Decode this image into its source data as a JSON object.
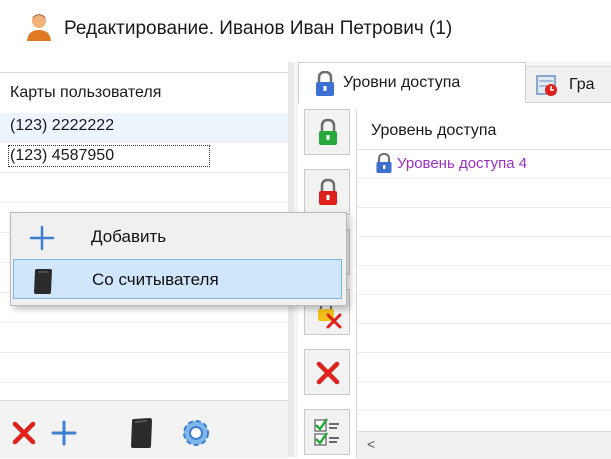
{
  "window": {
    "title": "Редактирование. Иванов Иван Петрович (1)",
    "icon": "user-icon"
  },
  "cards_panel": {
    "header": "Карты пользователя",
    "rows": [
      "(123) 2222222",
      "(123) 4587950"
    ],
    "toolbar": {
      "buttons": [
        "delete-icon",
        "add-icon",
        "card-reader-icon",
        "settings-icon"
      ]
    }
  },
  "context_menu": {
    "items": [
      {
        "label": "Добавить",
        "icon": "add-icon"
      },
      {
        "label": "Со считывателя",
        "icon": "card-reader-icon"
      }
    ],
    "highlighted_index": 1
  },
  "tabs": [
    {
      "label": "Уровни доступа",
      "icon": "lock-icon",
      "active": true
    },
    {
      "label": "Гра",
      "icon": "schedule-icon",
      "active": false
    }
  ],
  "access_levels": {
    "column_header": "Уровень доступа",
    "rows": [
      "Уровень доступа 4"
    ],
    "row_color": "#9b2fc6",
    "scroll_arrow": "<"
  },
  "side_toolbar": {
    "buttons": [
      "unlock-green-icon",
      "lock-red-icon",
      "lock-yellow-icon",
      "lock-remove-icon",
      "delete-icon",
      "checklist-icon"
    ]
  },
  "colors": {
    "accent_red": "#e0201b",
    "accent_blue": "#3d7fd0",
    "menu_highlight": "#cfe6fb"
  }
}
